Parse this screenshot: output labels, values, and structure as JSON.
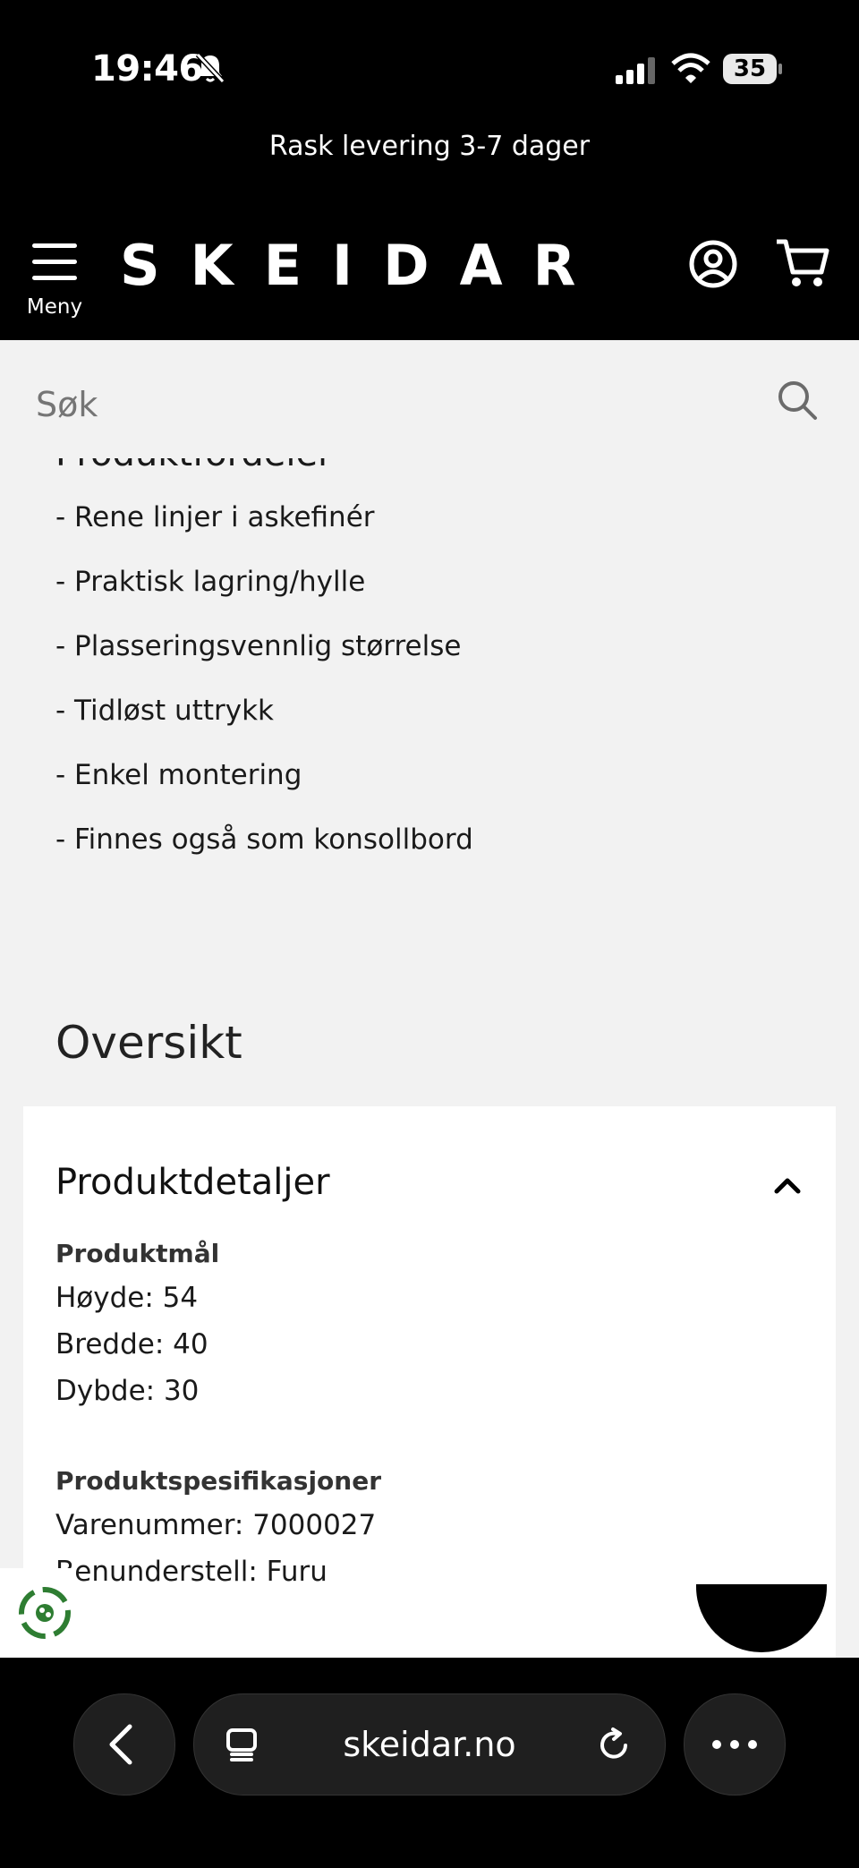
{
  "status_bar": {
    "time": "19:46",
    "battery": "35"
  },
  "promo": {
    "text": "Rask levering 3-7 dager"
  },
  "header": {
    "menu_label": "Meny",
    "logo": "SKEIDAR"
  },
  "search": {
    "placeholder": "Søk"
  },
  "benefits": {
    "title": "Produktfordeler",
    "items": [
      "- Rene linjer i askefinér",
      "- Praktisk lagring/hylle",
      "- Plasseringsvennlig størrelse",
      "- Tidløst uttrykk",
      "- Enkel montering",
      "- Finnes også som konsollbord"
    ]
  },
  "overview": {
    "title": "Oversikt"
  },
  "details": {
    "title": "Produktdetaljer",
    "dimensions_heading": "Produktmål",
    "dimensions": [
      "Høyde: 54",
      "Bredde: 40",
      "Dybde: 30"
    ],
    "specs_heading": "Produktspesifikasjoner",
    "specs": [
      "Varenummer: 7000027",
      "Benunderstell: Furu"
    ]
  },
  "browser": {
    "url": "skeidar.no"
  },
  "colors": {
    "background": "#f2f2f2",
    "header": "#000000",
    "card": "#ffffff",
    "eco_green": "#2e7d32"
  }
}
